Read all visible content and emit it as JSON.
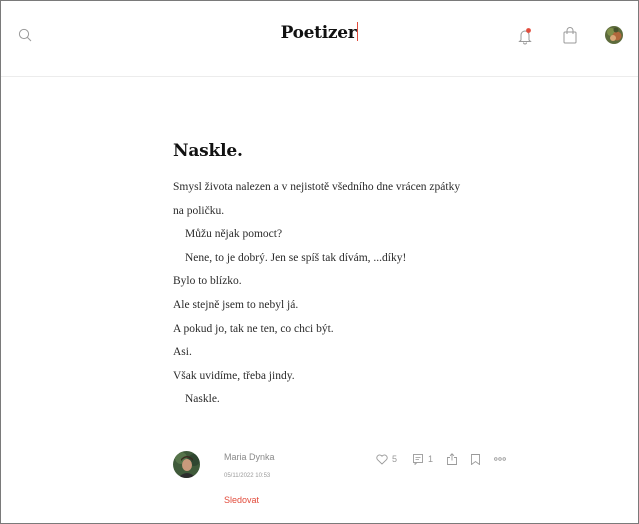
{
  "header": {
    "logo": "Poetizer",
    "icons": [
      "search-icon",
      "bell-icon",
      "bag-icon"
    ],
    "notification_dot_color": "#e24b3b"
  },
  "poem": {
    "title": "Naskle.",
    "lines": [
      {
        "text": "Smysl života nalezen a v nejistotě všedního dne vrácen zpátky",
        "indent": false
      },
      {
        "text": "na poličku.",
        "indent": false
      },
      {
        "text": "Můžu nějak pomoct?",
        "indent": true
      },
      {
        "text": "Nene, to je dobrý. Jen se spíš tak dívám, ...díky!",
        "indent": true
      },
      {
        "text": "Bylo to blízko.",
        "indent": false
      },
      {
        "text": "Ale stejně jsem to nebyl já.",
        "indent": false
      },
      {
        "text": "A pokud jo, tak ne ten, co chci být.",
        "indent": false
      },
      {
        "text": "Asi.",
        "indent": false
      },
      {
        "text": "Však uvidíme, třeba jindy.",
        "indent": false
      },
      {
        "text": "Naskle.",
        "indent": true
      }
    ]
  },
  "author": {
    "name": "Maria Dynka",
    "date": "05/11/2022 10:53",
    "follow_label": "Sledovat"
  },
  "actions": {
    "likes": "5",
    "comments": "1"
  },
  "colors": {
    "accent": "#e24b3b",
    "muted": "#999999"
  }
}
